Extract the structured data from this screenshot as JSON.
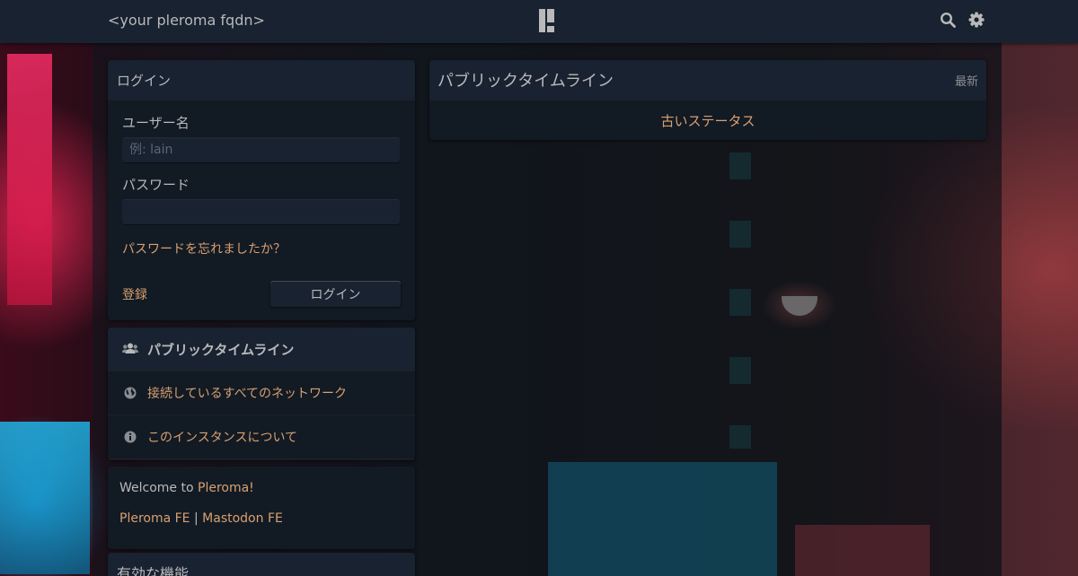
{
  "topbar": {
    "site_name": "<your pleroma fqdn>",
    "icons": [
      "search-icon",
      "gear-icon"
    ]
  },
  "login": {
    "title": "ログイン",
    "username_label": "ユーザー名",
    "username_placeholder": "例: lain",
    "password_label": "パスワード",
    "forgot_link": "パスワードを忘れましたか？",
    "register_link": "登録",
    "login_button": "ログイン"
  },
  "nav": {
    "items": [
      {
        "label": "パブリックタイムライン",
        "icon": "users-icon",
        "active": true
      },
      {
        "label": "接続しているすべてのネットワーク",
        "icon": "globe-icon",
        "active": false
      },
      {
        "label": "このインスタンスについて",
        "icon": "info-icon",
        "active": false
      }
    ]
  },
  "instance": {
    "welcome_prefix": "Welcome to ",
    "welcome_link": "Pleroma!",
    "pleroma_fe": "Pleroma FE",
    "separator": " | ",
    "mastodon_fe": "Mastodon FE"
  },
  "features": {
    "title": "有効な機能"
  },
  "timeline": {
    "title": "パブリックタイムライン",
    "newest": "最新",
    "older": "古いステータス"
  },
  "colors": {
    "panel_bg": "#121a24",
    "heading_bg": "#182230",
    "text": "#b9b9ba",
    "link": "#d8a070"
  }
}
